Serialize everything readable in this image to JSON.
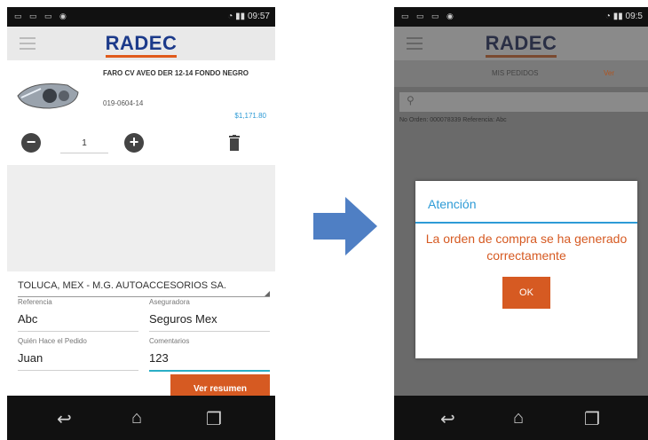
{
  "brand": {
    "logo_text": "RADEC",
    "accent": "#e05a1b",
    "logo_color": "#1c3a8a"
  },
  "left_screen": {
    "status_time": "09:57",
    "product": {
      "name": "FARO CV AVEO DER 12-14 FONDO NEGRO",
      "code": "019-0604-14",
      "price": "$1,171.80"
    },
    "quantity": "1",
    "dealer": "TOLUCA, MEX - M.G. AUTOACCESORIOS SA.",
    "fields": {
      "referencia": {
        "label": "Referencia",
        "value": "Abc"
      },
      "aseguradora": {
        "label": "Aseguradora",
        "value": "Seguros Mex"
      },
      "quien_hace": {
        "label": "Quién Hace el Pedido",
        "value": "Juan"
      },
      "comentarios": {
        "label": "Comentarios",
        "value": "123"
      }
    },
    "summary_button": "Ver resumen"
  },
  "right_screen": {
    "status_time": "09:5",
    "tabs": [
      "MIS PEDIDOS",
      "Ver"
    ],
    "search_icon": "search-icon",
    "row_text": "No Orden: 000078339      Referencia: Abc",
    "dialog": {
      "title": "Atención",
      "message": "La orden de compra se ha generado correctamente",
      "ok_label": "OK"
    }
  },
  "colors": {
    "orange": "#d65a22",
    "blue": "#2e9bd6",
    "accent_teal": "#2aaec6"
  }
}
